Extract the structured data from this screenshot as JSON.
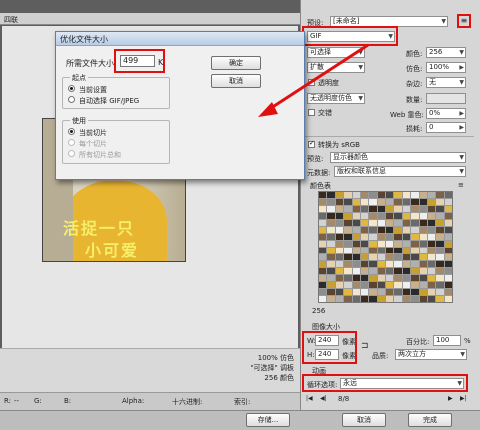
{
  "canvas": {
    "tab_label": "四联",
    "caption_lines": [
      "活捉一只",
      "小可爱"
    ],
    "info_lines": [
      "100% 仿色",
      "\"可选择\" 调板",
      "256 颜色"
    ]
  },
  "status": {
    "r_label": "R:",
    "g_label": "G:",
    "b_label": "B:",
    "r_value": "--",
    "alpha_label": "Alpha:",
    "hex_label": "十六进制:",
    "index_label": "索引:"
  },
  "bottom": {
    "save_label": "存储...",
    "cancel_label": "取消",
    "done_label": "完成"
  },
  "dialog": {
    "title": "优化文件大小",
    "size_label": "所需文件大小:",
    "size_value": "499",
    "size_unit": "K",
    "ok_label": "确定",
    "cancel_label": "取消",
    "start_group": "起点",
    "start_options": [
      {
        "label": "当前设置",
        "selected": true
      },
      {
        "label": "自动选择 GIF/JPEG",
        "selected": false
      }
    ],
    "use_group": "使用",
    "use_options": [
      {
        "label": "当前切片",
        "selected": true,
        "enabled": true
      },
      {
        "label": "每个切片",
        "selected": false,
        "enabled": false
      },
      {
        "label": "所有切片总和",
        "selected": false,
        "enabled": false
      }
    ]
  },
  "settings": {
    "preset_label": "预设:",
    "preset_value": "[未命名]",
    "format_value": "GIF",
    "reduction_value": "可选择",
    "colors_label": "颜色:",
    "colors_value": "256",
    "dither_algo_value": "扩散",
    "dither_label": "仿色:",
    "dither_value": "100%",
    "transparency_label": "透明度",
    "transparency_checked": true,
    "matte_label": "杂边:",
    "matte_value": "无",
    "trans_dither_value": "无透明度仿色",
    "amount_label": "数量:",
    "interlaced_label": "交错",
    "interlaced_checked": false,
    "websnap_label": "Web 靠色:",
    "websnap_value": "0%",
    "lossy_label": "损耗:",
    "lossy_value": "0",
    "srgb_label": "转换为 sRGB",
    "srgb_checked": true,
    "preview_label": "预览:",
    "preview_value": "显示器颜色",
    "metadata_label": "元数据:",
    "metadata_value": "版权和联系信息",
    "color_table_label": "颜色表",
    "color_count": "256"
  },
  "image_size": {
    "section_label": "图像大小",
    "w_label": "W:",
    "w_value": "240",
    "h_label": "H:",
    "h_value": "240",
    "unit": "像素",
    "percent_label": "百分比:",
    "percent_value": "100",
    "percent_unit": "%",
    "quality_label": "品质:",
    "quality_value": "两次立方"
  },
  "animation": {
    "section_label": "动画",
    "loop_label": "循环选项:",
    "loop_value": "永远",
    "frame_counter": "8/8"
  },
  "colors": {
    "annotation_red": "#e01010",
    "dialog_title_blue": "#b9cce6",
    "palette": [
      "#3a2a1e",
      "#5a4430",
      "#7d6248",
      "#a58a6a",
      "#c9b08c",
      "#e6d2b0",
      "#f4e6c8",
      "#2b2b2b",
      "#4a4a4a",
      "#6a6a6a",
      "#8d8d8d",
      "#b0b0b0",
      "#d2d2d2",
      "#efefef",
      "#c8a030",
      "#e0b840"
    ]
  }
}
